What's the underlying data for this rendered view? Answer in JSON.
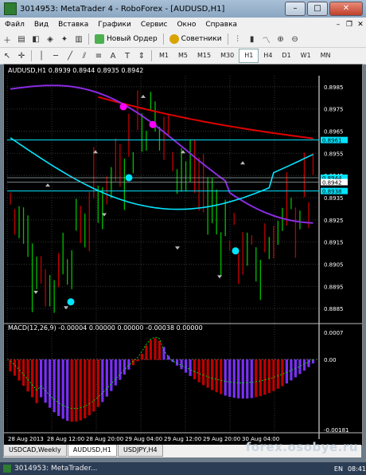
{
  "window": {
    "title": "3014953: MetaTrader 4 - RoboForex - [AUDUSD,H1]",
    "min": "–",
    "max": "□",
    "close": "✕"
  },
  "menu": {
    "items": [
      "Файл",
      "Вид",
      "Вставка",
      "Графики",
      "Сервис",
      "Окно",
      "Справка"
    ]
  },
  "toolbar": {
    "new_order": "Новый Ордер",
    "advisors": "Советники"
  },
  "timeframes": {
    "items": [
      "M1",
      "M5",
      "M15",
      "M30",
      "H1",
      "H4",
      "D1",
      "W1",
      "MN"
    ],
    "active": "H1"
  },
  "chart": {
    "symbol_info": "AUDUSD,H1  0.8939 0.8944 0.8935 0.8942",
    "price_labels": [
      "0.8985",
      "0.8975",
      "0.8965",
      "0.8955",
      "0.8945",
      "0.8935",
      "0.8925",
      "0.8915",
      "0.8905",
      "0.8895",
      "0.8885"
    ],
    "current_price_tags": [
      "0.8961",
      "0.8944",
      "0.8942",
      "0.8938"
    ],
    "time_labels": [
      "28 Aug 2013",
      "28 Aug 12:00",
      "28 Aug 20:00",
      "29 Aug 04:00",
      "29 Aug 12:00",
      "29 Aug 20:00",
      "30 Aug 04:00"
    ],
    "macd_info": "MACD(12,26,9)  -0.00004 0.00000 0.00000 -0.00038 0.00000",
    "macd_labels": [
      "0.0007",
      "0.00",
      "-0.00181"
    ],
    "colors": {
      "up_bar": "#00c000",
      "down_bar": "#c00000",
      "cyan": "#00e5ff",
      "purple": "#8a2be2",
      "red_ma": "#e00000",
      "magenta": "#ff00ff"
    }
  },
  "tabs": {
    "items": [
      "USDCAD,Weekly",
      "AUDUSD,H1",
      "USDJPY,H4"
    ],
    "active": "AUDUSD,H1"
  },
  "watermark": "forex.osobye.ru",
  "taskbar": {
    "item": "3014953: MetaTrader...",
    "lang": "EN",
    "clock": "08:41"
  }
}
